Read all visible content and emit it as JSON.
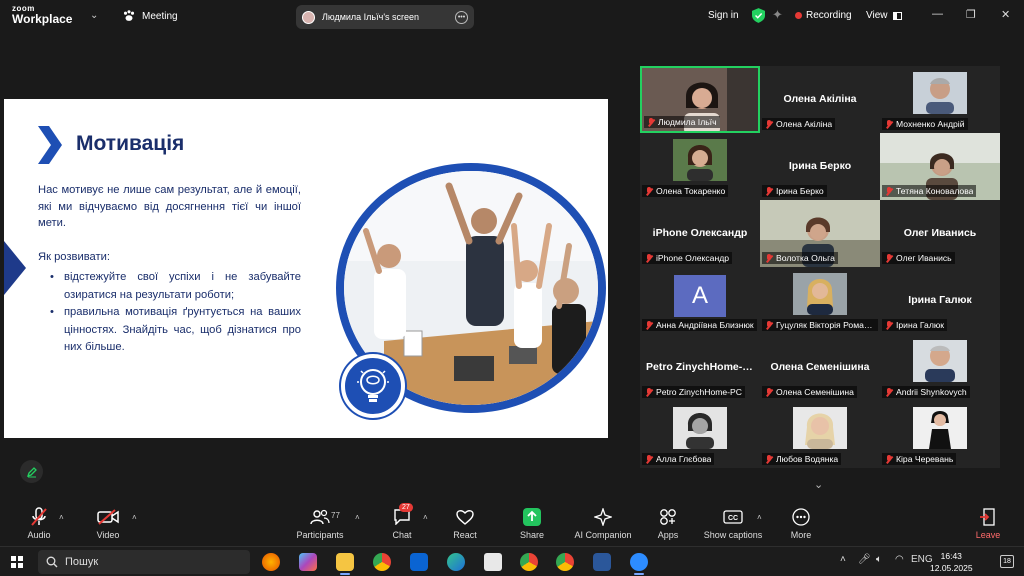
{
  "app": {
    "logo_line1": "zoom",
    "logo_line2": "Workplace",
    "meeting_label": "Meeting",
    "screen_share_label": "Людмила Ільїч's screen",
    "sign_in": "Sign in",
    "recording": "Recording",
    "view": "View"
  },
  "slide": {
    "title": "Мотивація",
    "paragraph": "Нас мотивує не лише сам результат, але й емоції, які ми відчуваємо від досягнення тієї чи іншої мети.",
    "subheading": "Як розвивати:",
    "bullets": [
      "відстежуйте свої успіхи і не забувайте озиратися на результати роботи;",
      "правильна мотивація ґрунтується на ваших цінностях. Знайдіть час, щоб дізнатися про них більше."
    ]
  },
  "gallery": {
    "tiles": [
      {
        "label": "Людмила Ільїч",
        "big": ""
      },
      {
        "label": "Олена Акіліна",
        "big": "Олена Акіліна"
      },
      {
        "label": "Мохненко Андрій",
        "big": ""
      },
      {
        "label": "Олена Токаренко",
        "big": ""
      },
      {
        "label": "Ірина Берко",
        "big": "Ірина Берко"
      },
      {
        "label": "Тетяна Коновалова",
        "big": ""
      },
      {
        "label": "iPhone Олександр",
        "big": "iPhone Олександр"
      },
      {
        "label": "Волотка Ольга",
        "big": ""
      },
      {
        "label": "Олег Иванись",
        "big": "Олег Иванись"
      },
      {
        "label": "Анна Андріївна Близнюк",
        "big": "",
        "initial": "A"
      },
      {
        "label": "Гуцуляк Вікторія Романівна",
        "big": ""
      },
      {
        "label": "Ірина Галюк",
        "big": "Ірина Галюк"
      },
      {
        "label": "Petro ZinychHome-PC",
        "big": "Petro ZinychHome-PC"
      },
      {
        "label": "Олена Семенішина",
        "big": "Олена Семенішина"
      },
      {
        "label": "Andrii Shynkovych",
        "big": ""
      },
      {
        "label": "Алла Глєбова",
        "big": ""
      },
      {
        "label": "Любов Водянка",
        "big": ""
      },
      {
        "label": "Кіра Черевань",
        "big": ""
      }
    ]
  },
  "toolbar": {
    "audio": "Audio",
    "video": "Video",
    "participants": "Participants",
    "participants_count": "77",
    "chat": "Chat",
    "chat_badge": "27",
    "react": "React",
    "share": "Share",
    "ai_companion": "AI Companion",
    "apps": "Apps",
    "show_captions": "Show captions",
    "more": "More",
    "leave": "Leave"
  },
  "taskbar": {
    "search_placeholder": "Пошук",
    "language": "ENG",
    "time": "16:43",
    "date": "12.05.2025",
    "notifications": "18"
  },
  "colors": {
    "slide_blue": "#1e3a8a",
    "active_speaker": "#23d160",
    "recording_red": "#e53935",
    "share_green": "#23c45e"
  }
}
